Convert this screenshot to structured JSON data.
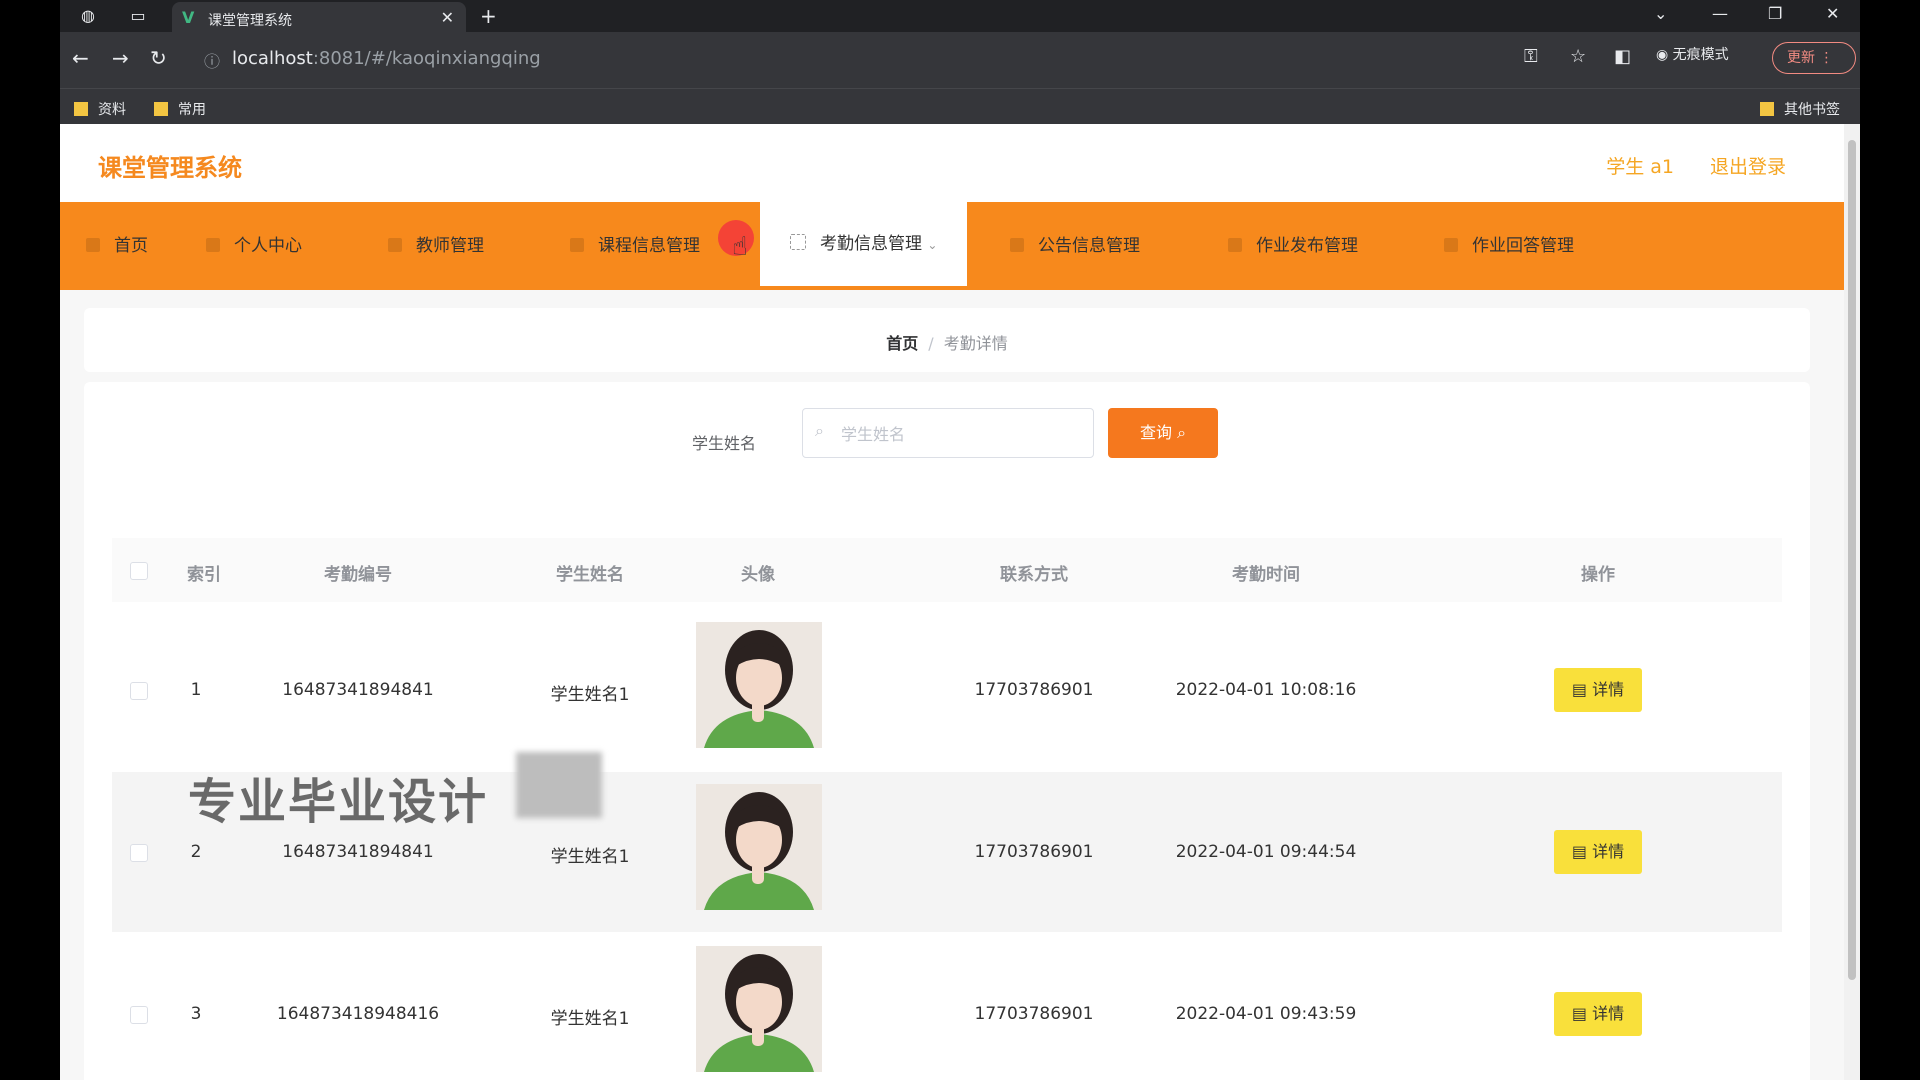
{
  "browser": {
    "tab_title": "课堂管理系统",
    "url_host": "localhost",
    "url_rest": ":8081/#/kaoqinxiangqing",
    "incognito_label": "无痕模式",
    "update_label": "更新",
    "bookmarks": [
      "资料",
      "常用"
    ],
    "other_bookmarks": "其他书签"
  },
  "header": {
    "logo": "课堂管理系统",
    "user": "学生 a1",
    "logout": "退出登录"
  },
  "menu": {
    "items": [
      "首页",
      "个人中心",
      "教师管理",
      "课程信息管理",
      "考勤信息管理",
      "公告信息管理",
      "作业发布管理",
      "作业回答管理"
    ],
    "active_index": 4
  },
  "breadcrumb": {
    "home": "首页",
    "separator": "/",
    "current": "考勤详情"
  },
  "search": {
    "label": "学生姓名",
    "placeholder": "学生姓名",
    "button": "查询"
  },
  "table": {
    "columns": [
      "索引",
      "考勤编号",
      "学生姓名",
      "头像",
      "联系方式",
      "考勤时间",
      "操作"
    ],
    "rows": [
      {
        "index": "1",
        "id": "16487341894841",
        "name": "学生姓名1",
        "phone": "17703786901",
        "time": "2022-04-01 10:08:16",
        "action": "详情"
      },
      {
        "index": "2",
        "id": "16487341894841",
        "name": "学生姓名1",
        "phone": "17703786901",
        "time": "2022-04-01 09:44:54",
        "action": "详情"
      },
      {
        "index": "3",
        "id": "164873418948416",
        "name": "学生姓名1",
        "phone": "17703786901",
        "time": "2022-04-01 09:43:59",
        "action": "详情"
      }
    ]
  },
  "overlay": {
    "watermark": "专业毕业设计"
  },
  "colors": {
    "accent": "#f7891c",
    "search_button": "#f5781e",
    "detail_button": "#f9e03b",
    "logo_text": "#f5891f"
  }
}
